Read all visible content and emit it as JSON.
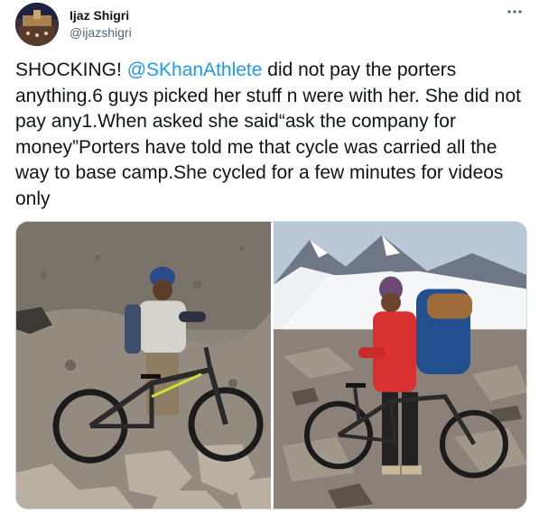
{
  "user": {
    "display_name": "Ijaz Shigri",
    "handle": "@ijazshigri"
  },
  "menu_icon": "more-horizontal-icon",
  "tweet": {
    "text_before_mention": "SHOCKING! ",
    "mention": "@SKhanAthlete",
    "text_after_mention": " did not pay the porters anything.6 guys picked her stuff n were with her. She did not pay any1.When asked she said“ask the company for money”Porters have told me that cycle was carried all the way to base camp.She cycled for a few minutes for videos only"
  },
  "media": {
    "count": 2
  },
  "colors": {
    "link": "#1d9bf0",
    "text": "#0f1419",
    "secondary": "#536471",
    "border": "#cfd9de"
  }
}
